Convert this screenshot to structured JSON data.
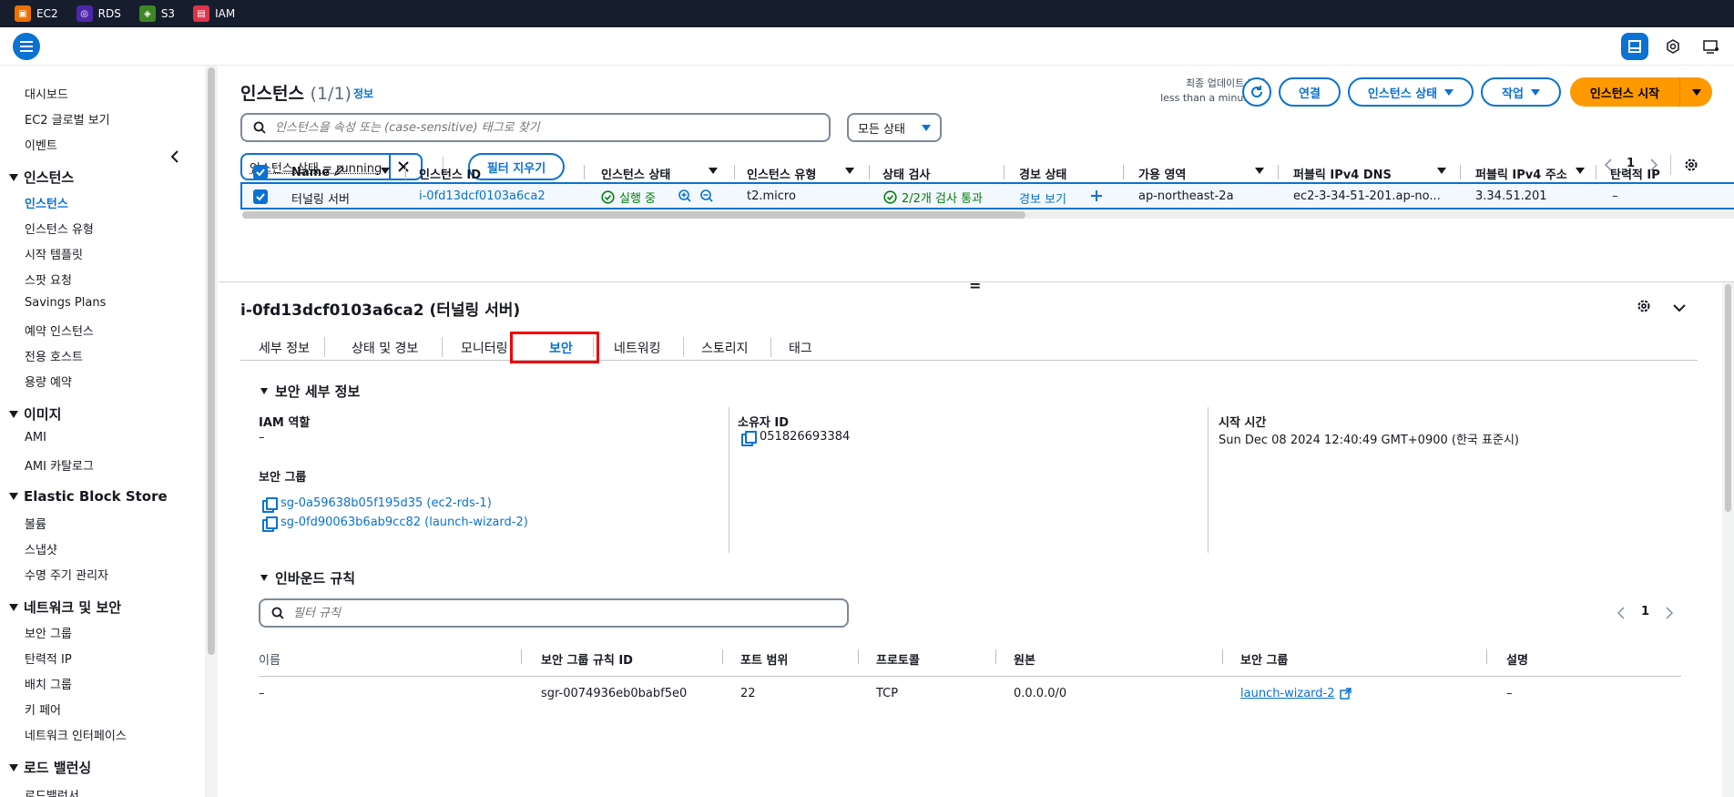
{
  "services": [
    {
      "label": "EC2",
      "icon": "ec2-icon",
      "color": "#ed7100"
    },
    {
      "label": "RDS",
      "icon": "rds-icon",
      "color": "#4d27aa"
    },
    {
      "label": "S3",
      "icon": "s3-icon",
      "color": "#3f8624"
    },
    {
      "label": "IAM",
      "icon": "iam-icon",
      "color": "#dd344c"
    }
  ],
  "sidebar": {
    "top_items": [
      "대시보드",
      "EC2 글로벌 보기",
      "이벤트"
    ],
    "sections": [
      {
        "title": "인스턴스",
        "items": [
          "인스턴스",
          "인스턴스 유형",
          "시작 템플릿",
          "스팟 요청",
          "Savings Plans",
          "예약 인스턴스",
          "전용 호스트",
          "용량 예약"
        ]
      },
      {
        "title": "이미지",
        "items": [
          "AMI",
          "AMI 카탈로그"
        ]
      },
      {
        "title": "Elastic Block Store",
        "items": [
          "볼륨",
          "스냅샷",
          "수명 주기 관리자"
        ]
      },
      {
        "title": "네트워크 및 보안",
        "items": [
          "보안 그룹",
          "탄력적 IP",
          "배치 그룹",
          "키 페어",
          "네트워크 인터페이스"
        ]
      },
      {
        "title": "로드 밸런싱",
        "items": [
          "로드밸런서"
        ]
      }
    ]
  },
  "instances": {
    "title": "인스턴스",
    "count": "(1/1)",
    "info": "정보",
    "last_updated_label": "최종 업데이트 날짜",
    "last_updated_value": "less than a minute 전",
    "connect": "연결",
    "state_btn": "인스턴스 상태",
    "actions_btn": "작업",
    "launch_btn": "인스턴스 시작",
    "search_placeholder": "인스턴스을 속성 또는 (case-sensitive) 태그로 찾기",
    "state_filter": "모든 상태",
    "token": "인스턴스 상태 = running",
    "clear_filters": "필터 지우기",
    "page": "1",
    "columns": [
      "Name",
      "인스턴스 ID",
      "인스턴스 상태",
      "인스턴스 유형",
      "상태 검사",
      "경보 상태",
      "가용 영역",
      "퍼블릭 IPv4 DNS",
      "퍼블릭 IPv4 주소",
      "탄력적 IP"
    ],
    "row": {
      "name": "터널링 서버",
      "id": "i-0fd13dcf0103a6ca2",
      "state": "실행 중",
      "type": "t2.micro",
      "check": "2/2개 검사 통과",
      "alarm": "경보 보기",
      "az": "ap-northeast-2a",
      "dns": "ec2-3-34-51-201.ap-no...",
      "ip": "3.34.51.201",
      "eip": "–"
    }
  },
  "detail": {
    "title": "i-0fd13dcf0103a6ca2 (터널링 서버)",
    "tabs": [
      "세부 정보",
      "상태 및 경보",
      "모니터링",
      "보안",
      "네트워킹",
      "스토리지",
      "태그"
    ],
    "security_section": "보안 세부 정보",
    "iam_role_label": "IAM 역할",
    "iam_role_value": "–",
    "owner_label": "소유자 ID",
    "owner_value": "051826693384",
    "launch_label": "시작 시간",
    "launch_value": "Sun Dec 08 2024 12:40:49 GMT+0900 (한국 표준시)",
    "sg_label": "보안 그룹",
    "sg_items": [
      "sg-0a59638b05f195d35 (ec2-rds-1)",
      "sg-0fd90063b6ab9cc82 (launch-wizard-2)"
    ],
    "inbound_section": "인바운드 규칙",
    "rules_placeholder": "필터 규칙",
    "rules_page": "1",
    "rule_columns": [
      "이름",
      "보안 그룹 규칙 ID",
      "포트 범위",
      "프로토콜",
      "원본",
      "보안 그룹",
      "설명"
    ],
    "rule_row": [
      "–",
      "sgr-0074936eb0babf5e0",
      "22",
      "TCP",
      "0.0.0.0/0",
      "launch-wizard-2",
      "–"
    ],
    "splitter": "="
  }
}
